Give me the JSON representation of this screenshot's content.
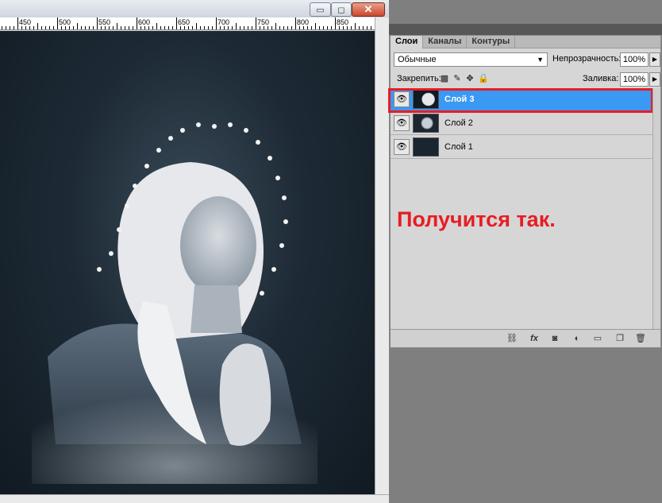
{
  "document_window": {
    "buttons": {
      "minimize": "▭",
      "maximize": "◻",
      "close": "✕"
    },
    "ruler_labels": [
      "450",
      "500",
      "550",
      "600",
      "650",
      "700",
      "750",
      "800",
      "850"
    ]
  },
  "layers_panel": {
    "tabs": [
      {
        "label": "Слои",
        "active": true
      },
      {
        "label": "Каналы",
        "active": false
      },
      {
        "label": "Контуры",
        "active": false
      }
    ],
    "blend_mode": "Обычные",
    "opacity_label": "Непрозрачность:",
    "opacity_value": "100%",
    "lock_label": "Закрепить:",
    "fill_label": "Заливка:",
    "fill_value": "100%",
    "layers": [
      {
        "name": "Слой 3",
        "selected": true
      },
      {
        "name": "Слой 2",
        "selected": false
      },
      {
        "name": "Слой 1",
        "selected": false
      }
    ],
    "annotation": "Получится так.",
    "colors": {
      "selection": "#3a99f2",
      "highlight": "#e81c24"
    }
  },
  "icons": {
    "eye": "eye-icon",
    "lock_transparency": "checker-icon",
    "lock_brush": "brush-icon",
    "lock_move": "move-icon",
    "lock_all": "lock-icon",
    "link": "link-icon",
    "fx": "fx-icon",
    "mask": "mask-icon",
    "adjustment": "adjustment-icon",
    "group": "folder-icon",
    "new_layer": "new-layer-icon",
    "delete": "trash-icon"
  }
}
